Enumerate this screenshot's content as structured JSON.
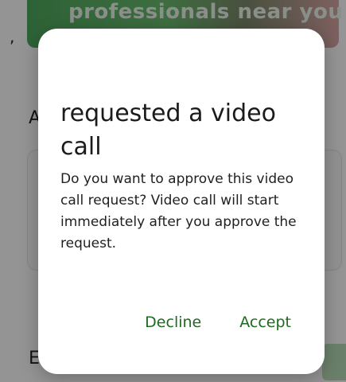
{
  "background": {
    "banner_text": "professionals near you",
    "comma": ",",
    "heading_a": "A",
    "heading_e": "E"
  },
  "dialog": {
    "title": "requested a video call",
    "message": "Do you want to approve this video call request? Video call will start immediately after you approve the request.",
    "decline_label": "Decline",
    "accept_label": "Accept"
  },
  "colors": {
    "accent": "#1d6b1f",
    "scrim": "rgba(0,0,0,0.42)"
  }
}
